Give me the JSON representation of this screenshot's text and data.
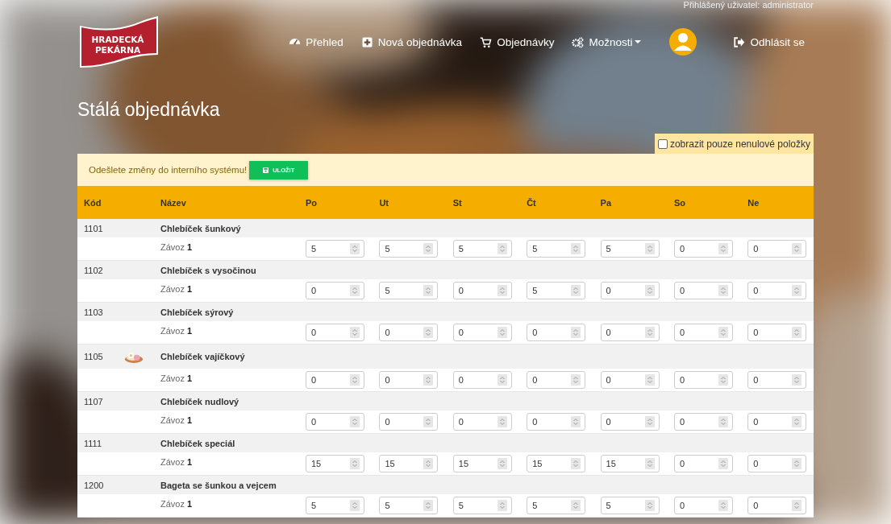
{
  "user_info": "Přihlášený uživatel: administrator",
  "logo": {
    "lines": [
      "HRADECKÁ",
      "PEKÁRNA"
    ]
  },
  "nav": [
    {
      "kind": "link",
      "label": "Přehled",
      "dropdown": false
    },
    {
      "kind": "link",
      "label": "Nová objednávka",
      "dropdown": false
    },
    {
      "kind": "link",
      "label": "Objednávky",
      "dropdown": false
    },
    {
      "kind": "link",
      "label": "Možnosti",
      "dropdown": true
    },
    {
      "kind": "avatar"
    },
    {
      "kind": "link",
      "label": "Odhlásit se",
      "dropdown": false
    }
  ],
  "page_title": "Stálá objednávka",
  "filter": {
    "label": "zobrazit pouze nenulové položky",
    "checked": false
  },
  "alert": {
    "message": "Odešlete změny do interního systému!",
    "button": "ULOŽIT"
  },
  "table": {
    "columns": [
      "Kód",
      "Název",
      "Po",
      "Ut",
      "St",
      "Čt",
      "Pa",
      "So",
      "Ne"
    ],
    "rows": [
      {
        "code": "1101",
        "name": "Chlebíček šunkový",
        "route": "Závoz **1**",
        "values": [
          "5",
          "5",
          "5",
          "5",
          "5",
          "0",
          "0"
        ]
      },
      {
        "code": "1102",
        "name": "Chlebíček s vysočinou",
        "route": "Závoz **1**",
        "values": [
          "0",
          "5",
          "0",
          "5",
          "0",
          "0",
          "0"
        ]
      },
      {
        "code": "1103",
        "name": "Chlebíček sýrový",
        "route": "Závoz **1**",
        "values": [
          "0",
          "0",
          "0",
          "0",
          "0",
          "0",
          "0"
        ]
      },
      {
        "code": "1105",
        "name": "Chlebíček vajíčkový",
        "route": "Závoz **1**",
        "values": [
          "0",
          "0",
          "0",
          "0",
          "0",
          "0",
          "0"
        ]
      },
      {
        "code": "1107",
        "name": "Chlebíček nudlový",
        "route": "Závoz **1**",
        "values": [
          "0",
          "0",
          "0",
          "0",
          "0",
          "0",
          "0"
        ]
      },
      {
        "code": "1111",
        "name": "Chlebíček speciál",
        "route": "Závoz **1**",
        "values": [
          "15",
          "15",
          "15",
          "15",
          "15",
          "0",
          "0"
        ]
      },
      {
        "code": "1200",
        "name": "Bageta se šunkou a vejcem",
        "route": "Závoz **1**",
        "values": [
          "5",
          "5",
          "5",
          "5",
          "5",
          "0",
          "0"
        ]
      }
    ]
  }
}
